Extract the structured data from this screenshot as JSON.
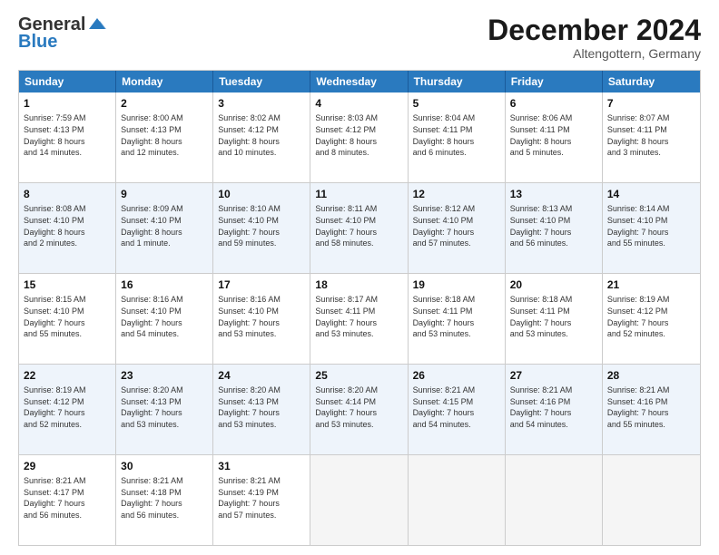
{
  "header": {
    "logo_line1": "General",
    "logo_line2": "Blue",
    "month": "December 2024",
    "location": "Altengottern, Germany"
  },
  "weekdays": [
    "Sunday",
    "Monday",
    "Tuesday",
    "Wednesday",
    "Thursday",
    "Friday",
    "Saturday"
  ],
  "rows": [
    [
      {
        "day": "1",
        "lines": [
          "Sunrise: 7:59 AM",
          "Sunset: 4:13 PM",
          "Daylight: 8 hours",
          "and 14 minutes."
        ]
      },
      {
        "day": "2",
        "lines": [
          "Sunrise: 8:00 AM",
          "Sunset: 4:13 PM",
          "Daylight: 8 hours",
          "and 12 minutes."
        ]
      },
      {
        "day": "3",
        "lines": [
          "Sunrise: 8:02 AM",
          "Sunset: 4:12 PM",
          "Daylight: 8 hours",
          "and 10 minutes."
        ]
      },
      {
        "day": "4",
        "lines": [
          "Sunrise: 8:03 AM",
          "Sunset: 4:12 PM",
          "Daylight: 8 hours",
          "and 8 minutes."
        ]
      },
      {
        "day": "5",
        "lines": [
          "Sunrise: 8:04 AM",
          "Sunset: 4:11 PM",
          "Daylight: 8 hours",
          "and 6 minutes."
        ]
      },
      {
        "day": "6",
        "lines": [
          "Sunrise: 8:06 AM",
          "Sunset: 4:11 PM",
          "Daylight: 8 hours",
          "and 5 minutes."
        ]
      },
      {
        "day": "7",
        "lines": [
          "Sunrise: 8:07 AM",
          "Sunset: 4:11 PM",
          "Daylight: 8 hours",
          "and 3 minutes."
        ]
      }
    ],
    [
      {
        "day": "8",
        "lines": [
          "Sunrise: 8:08 AM",
          "Sunset: 4:10 PM",
          "Daylight: 8 hours",
          "and 2 minutes."
        ]
      },
      {
        "day": "9",
        "lines": [
          "Sunrise: 8:09 AM",
          "Sunset: 4:10 PM",
          "Daylight: 8 hours",
          "and 1 minute."
        ]
      },
      {
        "day": "10",
        "lines": [
          "Sunrise: 8:10 AM",
          "Sunset: 4:10 PM",
          "Daylight: 7 hours",
          "and 59 minutes."
        ]
      },
      {
        "day": "11",
        "lines": [
          "Sunrise: 8:11 AM",
          "Sunset: 4:10 PM",
          "Daylight: 7 hours",
          "and 58 minutes."
        ]
      },
      {
        "day": "12",
        "lines": [
          "Sunrise: 8:12 AM",
          "Sunset: 4:10 PM",
          "Daylight: 7 hours",
          "and 57 minutes."
        ]
      },
      {
        "day": "13",
        "lines": [
          "Sunrise: 8:13 AM",
          "Sunset: 4:10 PM",
          "Daylight: 7 hours",
          "and 56 minutes."
        ]
      },
      {
        "day": "14",
        "lines": [
          "Sunrise: 8:14 AM",
          "Sunset: 4:10 PM",
          "Daylight: 7 hours",
          "and 55 minutes."
        ]
      }
    ],
    [
      {
        "day": "15",
        "lines": [
          "Sunrise: 8:15 AM",
          "Sunset: 4:10 PM",
          "Daylight: 7 hours",
          "and 55 minutes."
        ]
      },
      {
        "day": "16",
        "lines": [
          "Sunrise: 8:16 AM",
          "Sunset: 4:10 PM",
          "Daylight: 7 hours",
          "and 54 minutes."
        ]
      },
      {
        "day": "17",
        "lines": [
          "Sunrise: 8:16 AM",
          "Sunset: 4:10 PM",
          "Daylight: 7 hours",
          "and 53 minutes."
        ]
      },
      {
        "day": "18",
        "lines": [
          "Sunrise: 8:17 AM",
          "Sunset: 4:11 PM",
          "Daylight: 7 hours",
          "and 53 minutes."
        ]
      },
      {
        "day": "19",
        "lines": [
          "Sunrise: 8:18 AM",
          "Sunset: 4:11 PM",
          "Daylight: 7 hours",
          "and 53 minutes."
        ]
      },
      {
        "day": "20",
        "lines": [
          "Sunrise: 8:18 AM",
          "Sunset: 4:11 PM",
          "Daylight: 7 hours",
          "and 53 minutes."
        ]
      },
      {
        "day": "21",
        "lines": [
          "Sunrise: 8:19 AM",
          "Sunset: 4:12 PM",
          "Daylight: 7 hours",
          "and 52 minutes."
        ]
      }
    ],
    [
      {
        "day": "22",
        "lines": [
          "Sunrise: 8:19 AM",
          "Sunset: 4:12 PM",
          "Daylight: 7 hours",
          "and 52 minutes."
        ]
      },
      {
        "day": "23",
        "lines": [
          "Sunrise: 8:20 AM",
          "Sunset: 4:13 PM",
          "Daylight: 7 hours",
          "and 53 minutes."
        ]
      },
      {
        "day": "24",
        "lines": [
          "Sunrise: 8:20 AM",
          "Sunset: 4:13 PM",
          "Daylight: 7 hours",
          "and 53 minutes."
        ]
      },
      {
        "day": "25",
        "lines": [
          "Sunrise: 8:20 AM",
          "Sunset: 4:14 PM",
          "Daylight: 7 hours",
          "and 53 minutes."
        ]
      },
      {
        "day": "26",
        "lines": [
          "Sunrise: 8:21 AM",
          "Sunset: 4:15 PM",
          "Daylight: 7 hours",
          "and 54 minutes."
        ]
      },
      {
        "day": "27",
        "lines": [
          "Sunrise: 8:21 AM",
          "Sunset: 4:16 PM",
          "Daylight: 7 hours",
          "and 54 minutes."
        ]
      },
      {
        "day": "28",
        "lines": [
          "Sunrise: 8:21 AM",
          "Sunset: 4:16 PM",
          "Daylight: 7 hours",
          "and 55 minutes."
        ]
      }
    ],
    [
      {
        "day": "29",
        "lines": [
          "Sunrise: 8:21 AM",
          "Sunset: 4:17 PM",
          "Daylight: 7 hours",
          "and 56 minutes."
        ]
      },
      {
        "day": "30",
        "lines": [
          "Sunrise: 8:21 AM",
          "Sunset: 4:18 PM",
          "Daylight: 7 hours",
          "and 56 minutes."
        ]
      },
      {
        "day": "31",
        "lines": [
          "Sunrise: 8:21 AM",
          "Sunset: 4:19 PM",
          "Daylight: 7 hours",
          "and 57 minutes."
        ]
      },
      {
        "day": "",
        "lines": []
      },
      {
        "day": "",
        "lines": []
      },
      {
        "day": "",
        "lines": []
      },
      {
        "day": "",
        "lines": []
      }
    ]
  ]
}
